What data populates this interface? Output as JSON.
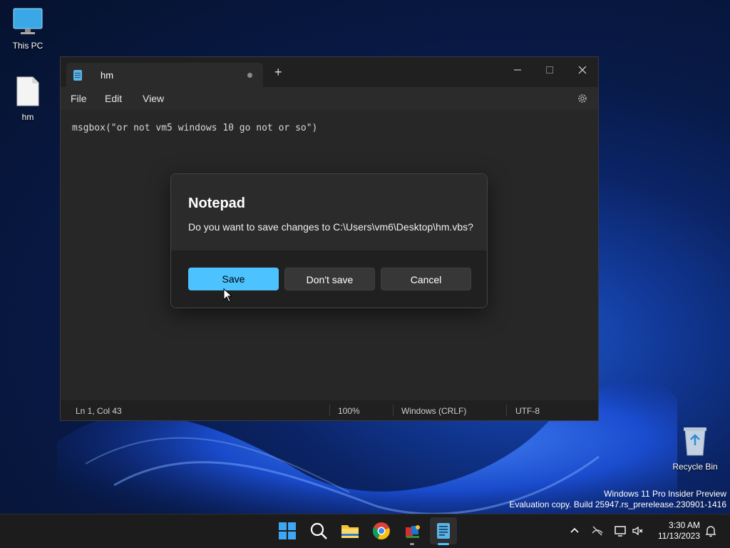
{
  "desktop": {
    "icons": [
      {
        "label": "This PC"
      },
      {
        "label": "hm"
      },
      {
        "label": "Recycle Bin"
      }
    ]
  },
  "notepad": {
    "tab_title": "hm",
    "new_tab": "+",
    "menu": {
      "file": "File",
      "edit": "Edit",
      "view": "View"
    },
    "content": "msgbox(\"or not vm5 windows 10 go not or so\")",
    "status": {
      "position": "Ln 1, Col 43",
      "zoom": "100%",
      "line_ending": "Windows (CRLF)",
      "encoding": "UTF-8"
    }
  },
  "dialog": {
    "title": "Notepad",
    "message": "Do you want to save changes to C:\\Users\\vm6\\Desktop\\hm.vbs?",
    "save": "Save",
    "dont_save": "Don't save",
    "cancel": "Cancel"
  },
  "watermark": {
    "line1": "Windows 11 Pro Insider Preview",
    "line2": "Evaluation copy. Build 25947.rs_prerelease.230901-1416"
  },
  "taskbar": {
    "time": "3:30 AM",
    "date": "11/13/2023",
    "icons": [
      "start-icon",
      "search-icon",
      "file-explorer-icon",
      "chrome-icon",
      "app-icon",
      "notepad-icon"
    ]
  },
  "colors": {
    "accent": "#4cc2ff",
    "window_bg": "#272727",
    "titlebar_bg": "#202020"
  }
}
